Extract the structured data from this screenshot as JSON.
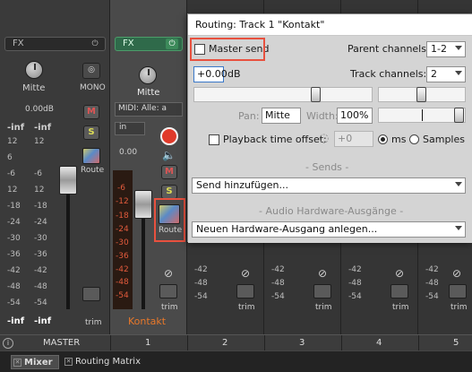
{
  "master": {
    "fx_label": "FX",
    "pan_label": "Mitte",
    "mono_label": "MONO",
    "volume_db": "0.00dB",
    "peak_left": "-inf",
    "peak_right": "-inf",
    "bottom_left": "-inf",
    "bottom_right": "-inf",
    "route_label": "Route",
    "trim_label": "trim",
    "name": "MASTER",
    "scale_left": [
      "12",
      "6",
      "-6",
      "12",
      "-18",
      "-24",
      "-30",
      "-36",
      "-42",
      "-48",
      "-54"
    ],
    "scale_right": [
      "12",
      "-6",
      "12",
      "-18",
      "-24",
      "-30",
      "-36",
      "-42",
      "-48",
      "-54"
    ]
  },
  "kontakt": {
    "fx_label": "FX",
    "pan_label": "Mitte",
    "midi_input": "MIDI: Alle: a",
    "input_mode": "in",
    "peak": "0.00",
    "route_label": "Route",
    "trim_label": "trim",
    "name": "Kontakt",
    "number": "1",
    "scale": [
      "-6",
      "-12",
      "-18",
      "-24",
      "-30",
      "-36",
      "-42",
      "-48",
      "-54"
    ]
  },
  "tracks": [
    {
      "number": "2",
      "trim_label": "trim",
      "scale": [
        "-42",
        "-48",
        "-54"
      ]
    },
    {
      "number": "3",
      "trim_label": "trim",
      "scale": [
        "-42",
        "-48",
        "-54"
      ]
    },
    {
      "number": "4",
      "trim_label": "trim",
      "scale": [
        "-42",
        "-48",
        "-54"
      ]
    },
    {
      "number": "5",
      "trim_label": "trim",
      "scale": [
        "-42",
        "-48",
        "-54"
      ]
    }
  ],
  "tabs": [
    {
      "label": "Mixer"
    },
    {
      "label": "Routing Matrix"
    }
  ],
  "dialog": {
    "title": "Routing: Track 1 \"Kontakt\"",
    "master_send_label": "Master send",
    "parent_channels_label": "Parent channels:",
    "parent_channels_value": "1-2",
    "volume_value": "+0.00",
    "volume_unit": "dB",
    "track_channels_label": "Track channels:",
    "track_channels_value": "2",
    "pan_label": "Pan:",
    "pan_value": "Mitte",
    "width_label": "Width:",
    "width_value": "100%",
    "playback_offset_label": "Playback time offset:",
    "playback_offset_value": "+0",
    "ms_label": "ms",
    "samples_label": "Samples",
    "sends_header": "- Sends -",
    "add_send_label": "Send hinzufügen...",
    "hw_outputs_header": "- Audio Hardware-Ausgänge -",
    "add_hw_output_label": "Neuen Hardware-Ausgang anlegen..."
  },
  "colors": {
    "highlight": "#e8513f",
    "kontakt_name": "#e8782a",
    "record_arm": "#e03a2a"
  }
}
